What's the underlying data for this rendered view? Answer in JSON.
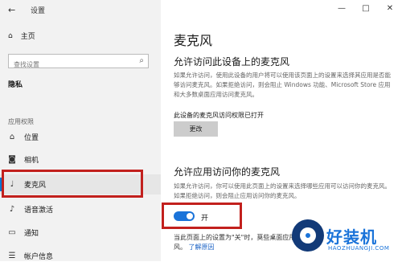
{
  "window": {
    "title": "设置",
    "minimize": "—",
    "maximize": "□",
    "close": "✕"
  },
  "sidebar": {
    "back_icon": "back-arrow-icon",
    "home_label": "主页",
    "search_placeholder": "查找设置",
    "section_privacy": "隐私",
    "section_app_permissions": "应用权限",
    "items": [
      {
        "label": "位置",
        "icon": "location-icon"
      },
      {
        "label": "相机",
        "icon": "camera-icon"
      },
      {
        "label": "麦克风",
        "icon": "microphone-icon",
        "active": true
      },
      {
        "label": "语音激活",
        "icon": "voice-activation-icon"
      },
      {
        "label": "通知",
        "icon": "notifications-icon"
      },
      {
        "label": "帐户信息",
        "icon": "account-info-icon"
      }
    ]
  },
  "main": {
    "page_title": "麦克风",
    "section1_title": "允许访问此设备上的麦克风",
    "section1_desc": "如果允许访问，使用此设备的用户将可以使用该页面上的设置来选择其应用是否能够访问麦克风。如果拒绝访问，则会阻止 Windows 功能、Microsoft Store 应用和大多数桌面应用访问麦克风。",
    "device_state": "此设备的麦克风访问权限已打开",
    "change_button": "更改",
    "section2_title": "允许应用访问你的麦克风",
    "section2_desc": "如果允许访问，你可以使用此页面上的设置来选择哪些应用可以访问你的麦克风。如果拒绝访问，则会阻止应用访问你的麦克风。",
    "toggle_state": "开",
    "toggle_on": true,
    "footer_text": "当此页面上的设置为\"关\"时，莫些桌面应用",
    "footer_text2": "风。",
    "footer_link": "了解原因"
  },
  "watermark": {
    "text": "好装机",
    "sub": "HAOZHUANGJI.COM"
  },
  "colors": {
    "accent": "#0078d4",
    "highlight_box": "#c2201d",
    "toggle": "#1a73d9"
  }
}
